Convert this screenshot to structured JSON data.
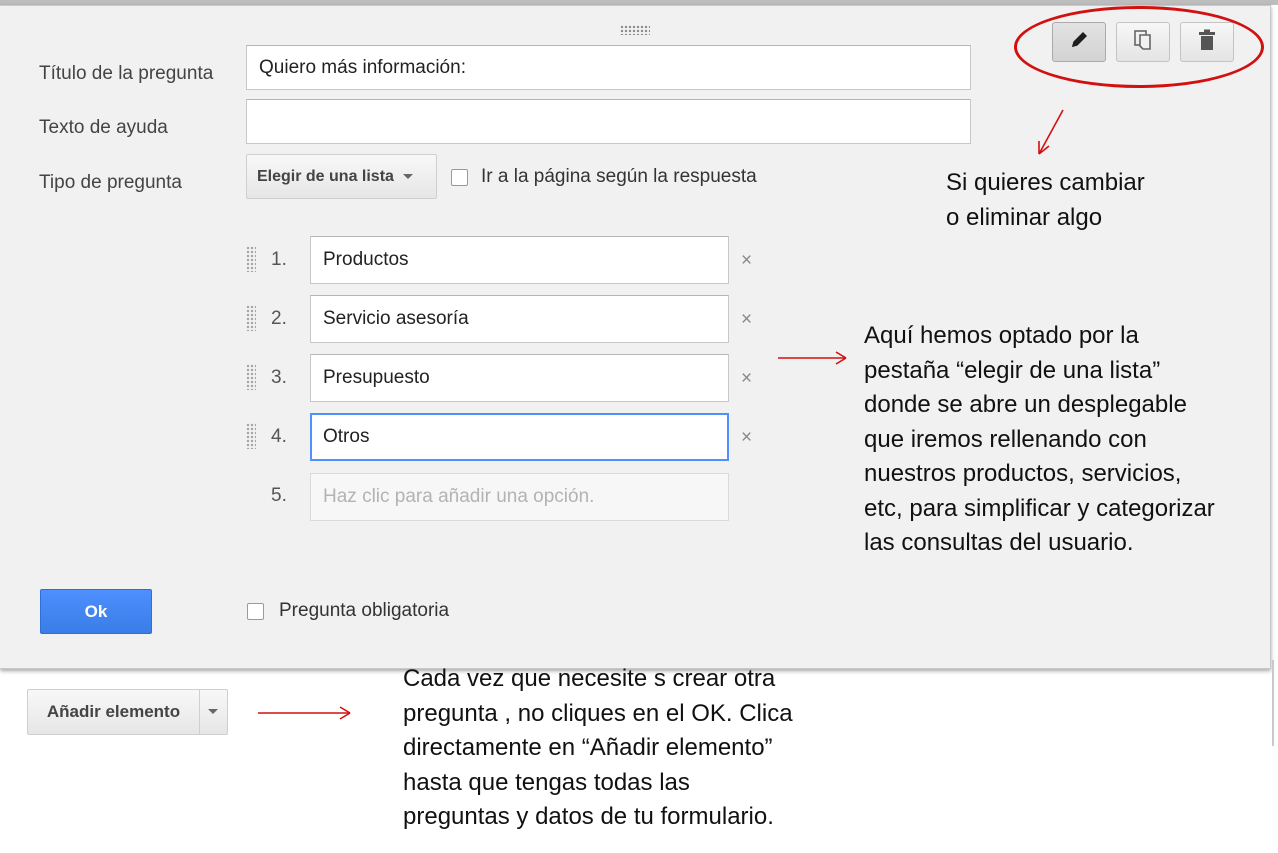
{
  "form": {
    "title_label": "Título de la pregunta",
    "title_value": "Quiero más información:",
    "help_label": "Texto de ayuda",
    "help_value": "",
    "type_label": "Tipo de pregunta",
    "type_value": "Elegir de una lista",
    "go_to_page_label": "Ir a la página según la respuesta",
    "options": [
      {
        "num": "1.",
        "value": "Productos"
      },
      {
        "num": "2.",
        "value": "Servicio asesoría"
      },
      {
        "num": "3.",
        "value": "Presupuesto"
      },
      {
        "num": "4.",
        "value": "Otros"
      }
    ],
    "new_option": {
      "num": "5.",
      "placeholder": "Haz clic para añadir una opción."
    },
    "remove_symbol": "×",
    "required_label": "Pregunta obligatoria",
    "ok_label": "Ok"
  },
  "toolbar": {
    "edit_icon": "pencil-icon",
    "duplicate_icon": "copy-icon",
    "delete_icon": "trash-icon"
  },
  "add_item": {
    "label": "Añadir elemento"
  },
  "annotations": {
    "toolbar_note": [
      "Si quieres cambiar",
      "o eliminar algo"
    ],
    "list_note": [
      "Aquí hemos optado por la",
      "pestaña “elegir de una lista”",
      "donde se abre un desplegable",
      "que iremos rellenando con",
      "nuestros productos, servicios,",
      "etc, para simplificar y categorizar",
      "las consultas del usuario."
    ],
    "add_note": [
      "Cada vez que  necesite s crear otra",
      "pregunta , no cliques en el OK. Clica",
      "directamente en “Añadir elemento”",
      "hasta que tengas  todas las",
      "preguntas y datos de tu formulario."
    ]
  },
  "colors": {
    "accent_blue": "#4d90fe",
    "annotation_red": "#d21010",
    "panel_bg": "#f1f1f1"
  }
}
